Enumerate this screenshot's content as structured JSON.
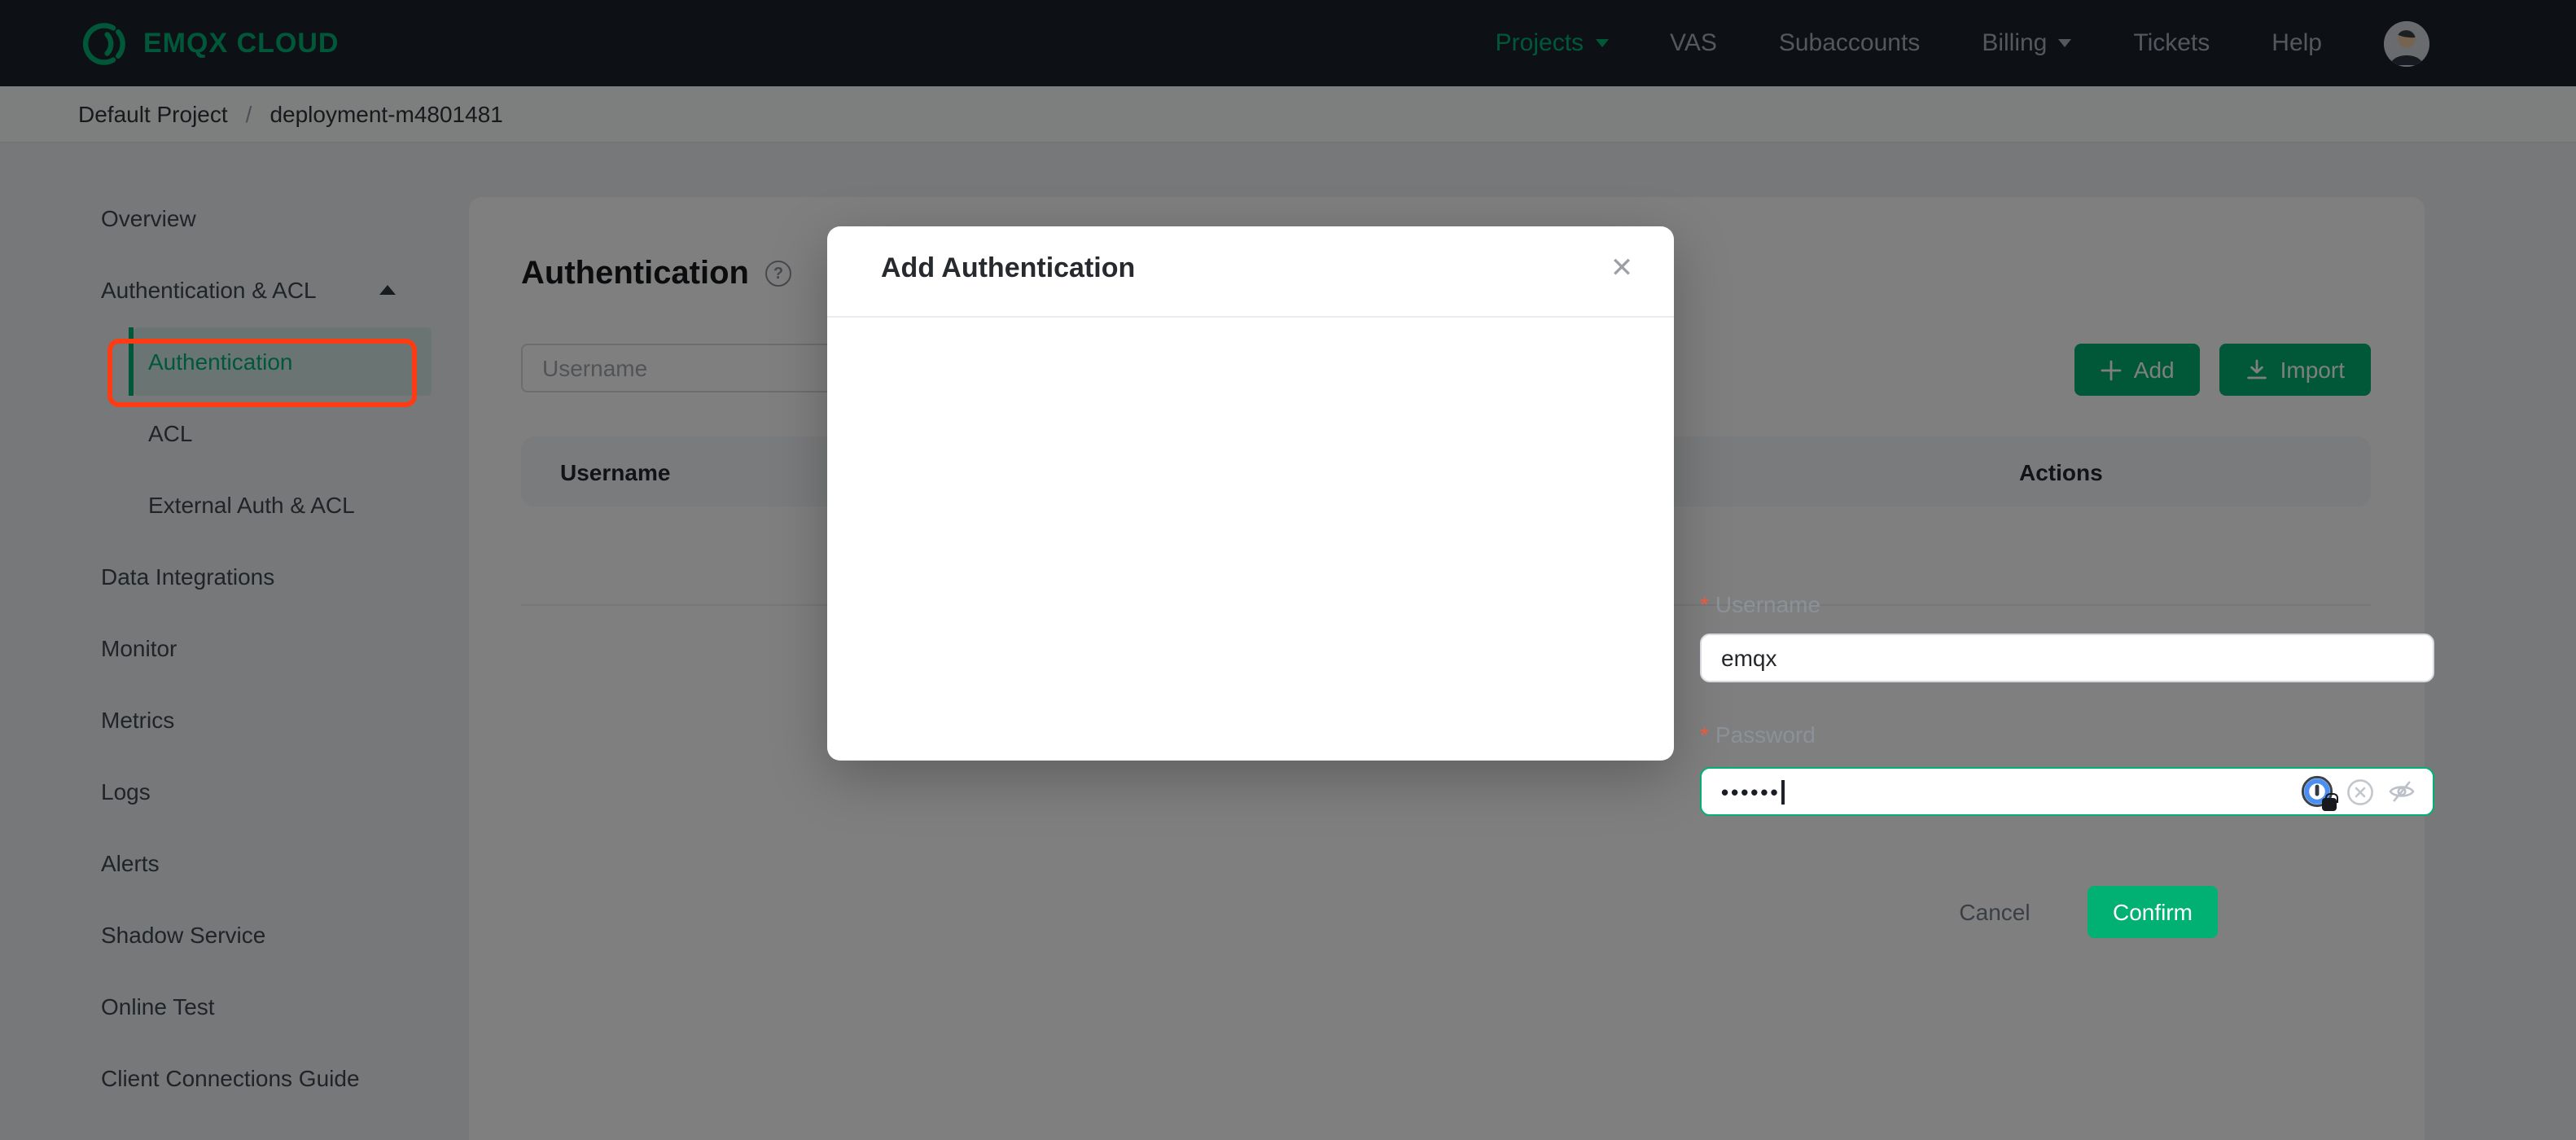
{
  "navbar": {
    "logo_text": "EMQX CLOUD",
    "items": [
      {
        "label": "Projects"
      },
      {
        "label": "VAS"
      },
      {
        "label": "Subaccounts"
      },
      {
        "label": "Billing"
      },
      {
        "label": "Tickets"
      },
      {
        "label": "Help"
      }
    ]
  },
  "breadcrumb": {
    "project": "Default Project",
    "separator": "/",
    "deployment": "deployment-m4801481"
  },
  "sidebar": {
    "items": [
      {
        "label": "Overview"
      },
      {
        "label": "Authentication & ACL"
      },
      {
        "label": "Authentication"
      },
      {
        "label": "ACL"
      },
      {
        "label": "External Auth & ACL"
      },
      {
        "label": "Data Integrations"
      },
      {
        "label": "Monitor"
      },
      {
        "label": "Metrics"
      },
      {
        "label": "Logs"
      },
      {
        "label": "Alerts"
      },
      {
        "label": "Shadow Service"
      },
      {
        "label": "Online Test"
      },
      {
        "label": "Client Connections Guide"
      }
    ]
  },
  "content": {
    "title": "Authentication",
    "search_placeholder": "Username",
    "add_label": "Add",
    "import_label": "Import",
    "table": {
      "headers": [
        "Username",
        "Actions"
      ]
    }
  },
  "modal": {
    "title": "Add Authentication",
    "close_glyph": "✕",
    "username_label": "Username",
    "username_value": "emqx",
    "password_label": "Password",
    "password_masked": "••••••",
    "required_mark": "*",
    "cancel_label": "Cancel",
    "confirm_label": "Confirm"
  },
  "colors": {
    "accent_green": "#00b173",
    "annotation_red": "#ff3b13",
    "asterisk_orange": "#f0583a",
    "navbar_bg": "#1b222c",
    "onepassword_blue": "#4b8ff5"
  }
}
